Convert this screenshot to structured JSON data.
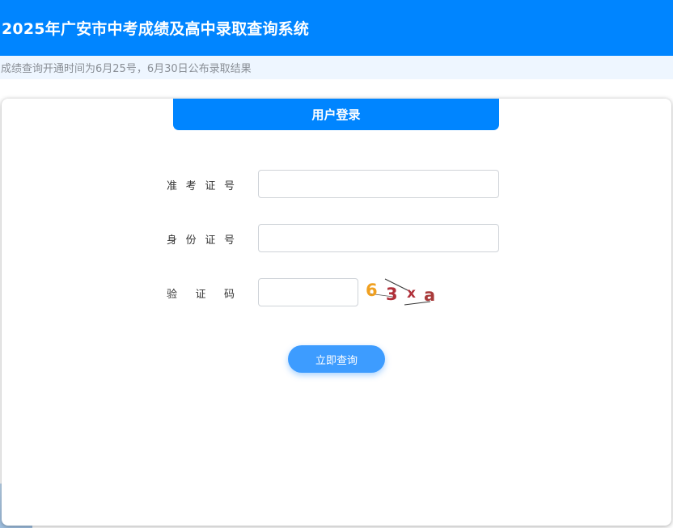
{
  "header": {
    "title": "2025年广安市中考成绩及高中录取查询系统"
  },
  "notice": {
    "text": "成绩查询开通时间为6月25号，6月30日公布录取结果"
  },
  "login": {
    "tab_label": "用户登录",
    "fields": [
      {
        "label_chars": [
          "准",
          "考",
          "证",
          "号"
        ],
        "value": "",
        "placeholder": ""
      },
      {
        "label_chars": [
          "身",
          "份",
          "证",
          "号"
        ],
        "value": "",
        "placeholder": ""
      },
      {
        "label_chars": [
          "验",
          "证",
          "码"
        ],
        "value": "",
        "placeholder": ""
      }
    ],
    "captcha_text": "63xa",
    "submit_label": "立即查询"
  },
  "colors": {
    "primary": "#0085ff",
    "button": "#3d9cff",
    "notice_bg": "#eef6ff"
  }
}
